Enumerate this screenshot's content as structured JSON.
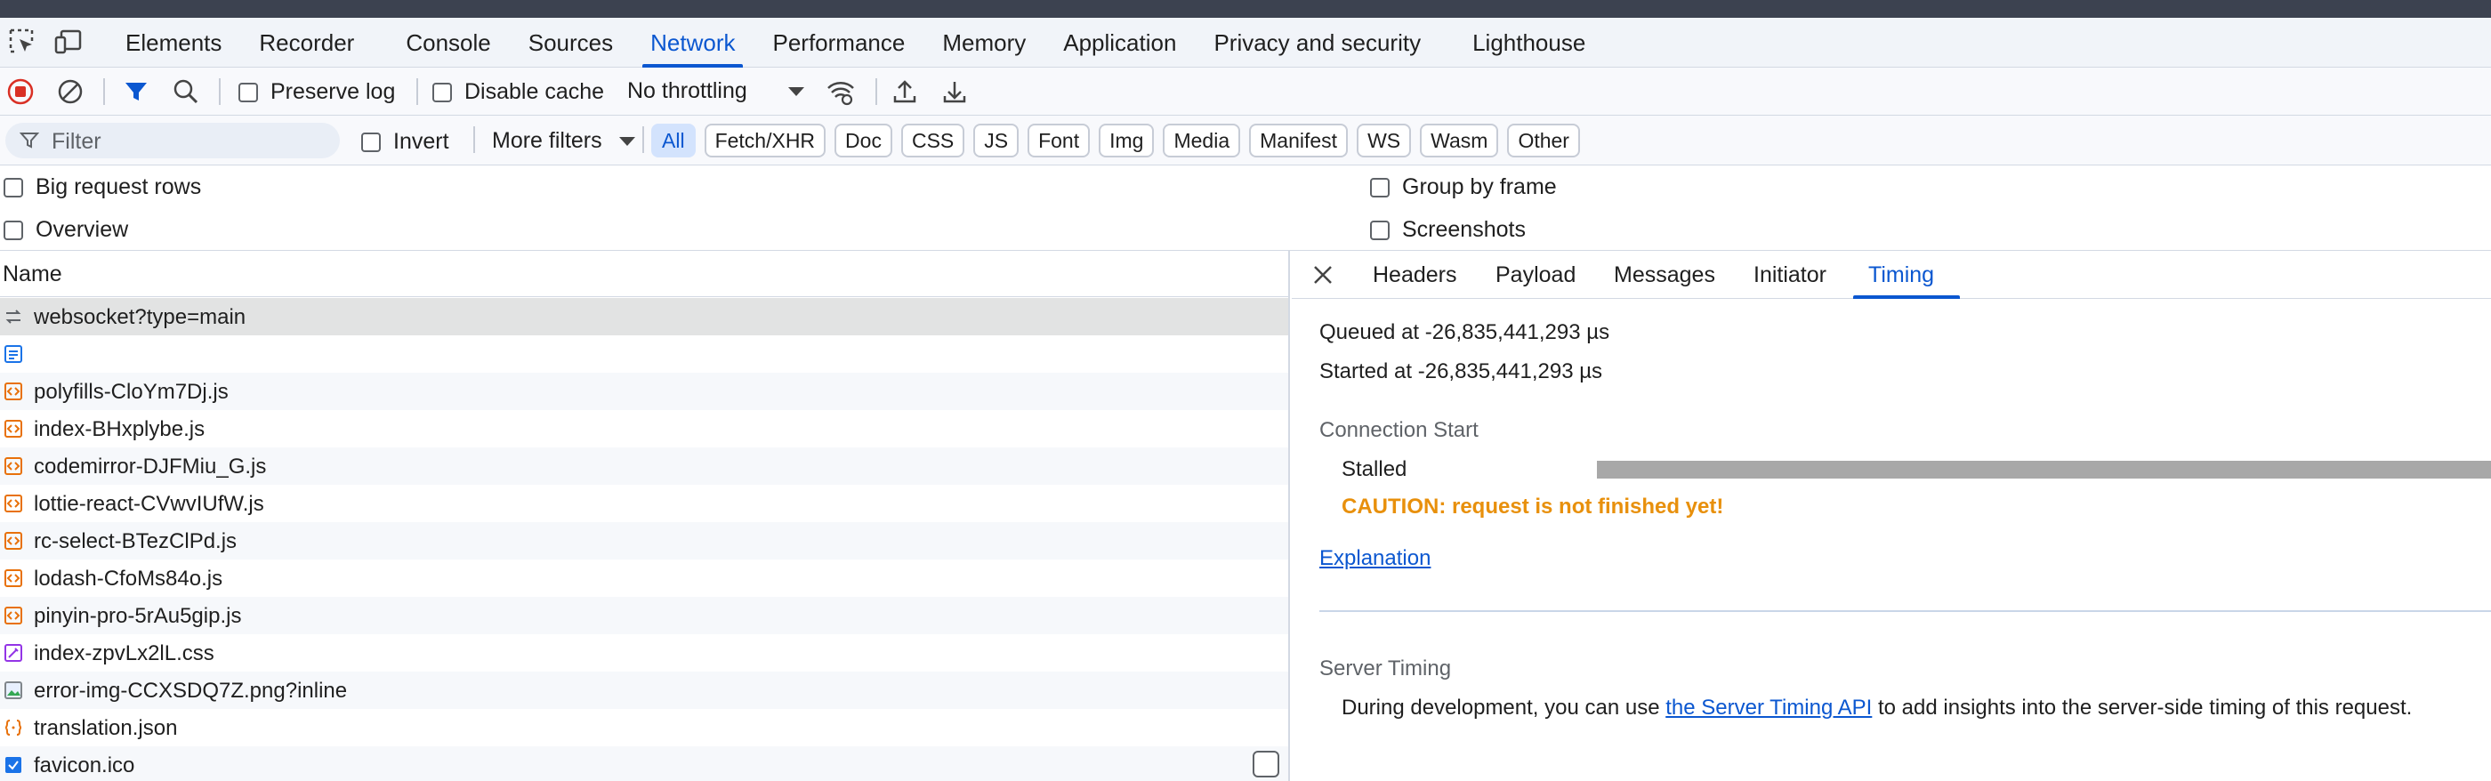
{
  "panel_tabs": [
    {
      "label": "Elements"
    },
    {
      "label": "Recorder"
    },
    {
      "label": "Console"
    },
    {
      "label": "Sources"
    },
    {
      "label": "Network",
      "active": true
    },
    {
      "label": "Performance"
    },
    {
      "label": "Memory"
    },
    {
      "label": "Application"
    },
    {
      "label": "Privacy and security"
    },
    {
      "label": "Lighthouse"
    }
  ],
  "toolbar": {
    "preserve_log": "Preserve log",
    "disable_cache": "Disable cache",
    "throttling": "No throttling"
  },
  "filterbar": {
    "filter_placeholder": "Filter",
    "invert": "Invert",
    "more_filters": "More filters",
    "chips": [
      "All",
      "Fetch/XHR",
      "Doc",
      "CSS",
      "JS",
      "Font",
      "Img",
      "Media",
      "Manifest",
      "WS",
      "Wasm",
      "Other"
    ],
    "active_chip": "All"
  },
  "settings": {
    "big_rows": "Big request rows",
    "overview": "Overview",
    "group_by_frame": "Group by frame",
    "screenshots": "Screenshots"
  },
  "list": {
    "header": "Name",
    "rows": [
      {
        "name": "websocket?type=main",
        "icon": "websocket-icon",
        "selected": true
      },
      {
        "name": "",
        "icon": "document-icon"
      },
      {
        "name": "polyfills-CloYm7Dj.js",
        "icon": "script-icon"
      },
      {
        "name": "index-BHxplybe.js",
        "icon": "script-icon"
      },
      {
        "name": "codemirror-DJFMiu_G.js",
        "icon": "script-icon"
      },
      {
        "name": "lottie-react-CVwvIUfW.js",
        "icon": "script-icon"
      },
      {
        "name": "rc-select-BTezClPd.js",
        "icon": "script-icon"
      },
      {
        "name": "lodash-CfoMs84o.js",
        "icon": "script-icon"
      },
      {
        "name": "pinyin-pro-5rAu5gip.js",
        "icon": "script-icon"
      },
      {
        "name": "index-zpvLx2lL.css",
        "icon": "stylesheet-icon"
      },
      {
        "name": "error-img-CCXSDQ7Z.png?inline",
        "icon": "image-icon"
      },
      {
        "name": "translation.json",
        "icon": "json-icon"
      },
      {
        "name": "favicon.ico",
        "icon": "favicon-icon"
      }
    ]
  },
  "detail": {
    "tabs": [
      "Headers",
      "Payload",
      "Messages",
      "Initiator",
      "Timing"
    ],
    "active_tab": "Timing",
    "queued": "Queued at -26,835,441,293 µs",
    "started": "Started at -26,835,441,293 µs",
    "connection_start": "Connection Start",
    "stalled": "Stalled",
    "caution": "CAUTION: request is not finished yet!",
    "explanation": "Explanation",
    "server_timing": "Server Timing",
    "server_text_before": "During development, you can use ",
    "server_link": "the Server Timing API",
    "server_text_after": " to add insights into the server-side timing of this request."
  },
  "colors": {
    "accent": "#0b57d0",
    "caution": "#e8900c",
    "record": "#d93025"
  }
}
